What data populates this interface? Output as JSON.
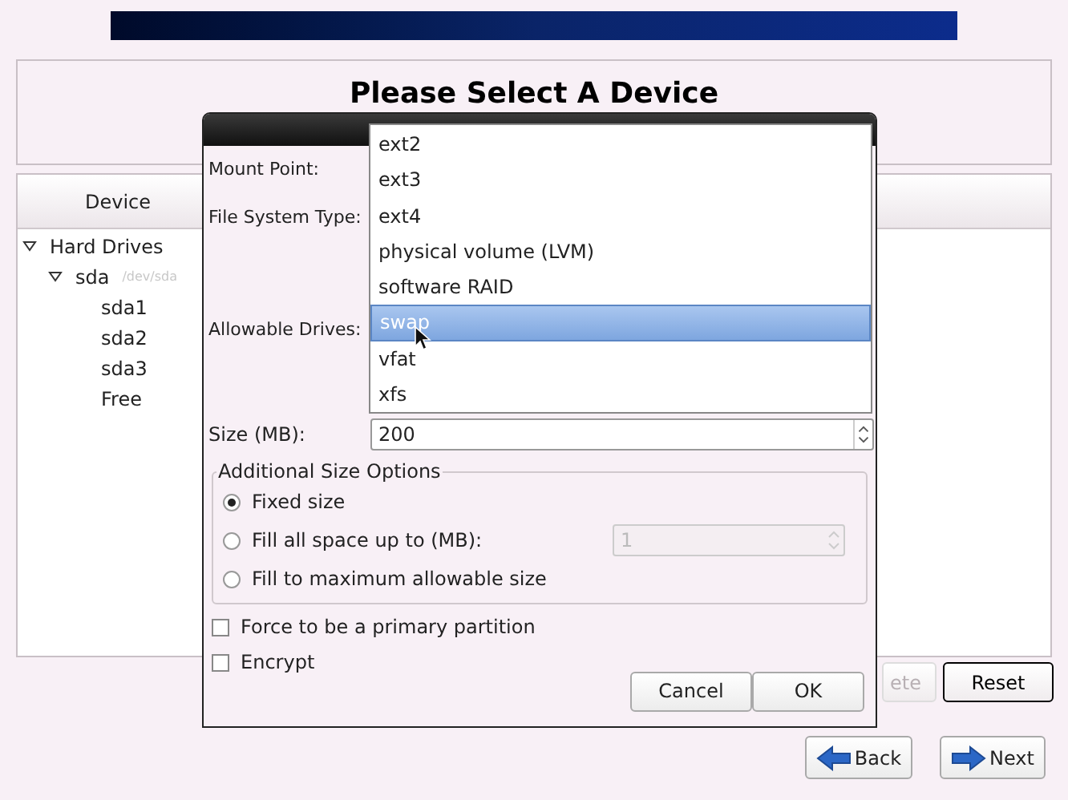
{
  "page": {
    "title": "Please Select A Device"
  },
  "device_panel": {
    "column": "Device",
    "tree": [
      {
        "label": "Hard Drives",
        "expanded": true,
        "children": [
          {
            "label": "sda",
            "path": "/dev/sda",
            "expanded": true,
            "children": [
              {
                "label": "sda1"
              },
              {
                "label": "sda2"
              },
              {
                "label": "sda3"
              },
              {
                "label": "Free"
              }
            ]
          }
        ]
      }
    ]
  },
  "panel_buttons": [
    {
      "label": "ete",
      "disabled": true
    },
    {
      "label": "Reset",
      "disabled": false
    }
  ],
  "nav_buttons": [
    {
      "label": "Back",
      "kind": "back"
    },
    {
      "label": "Next",
      "kind": "next"
    }
  ],
  "dialog": {
    "labels": [
      "Mount Point:",
      "File System Type:",
      "Allowable Drives:"
    ],
    "dropdown": [
      {
        "label": "ext2",
        "selected": false
      },
      {
        "label": "ext3",
        "selected": false
      },
      {
        "label": "ext4",
        "selected": false
      },
      {
        "label": "physical volume (LVM)",
        "selected": false
      },
      {
        "label": "software RAID",
        "selected": false
      },
      {
        "label": "swap",
        "selected": true
      },
      {
        "label": "vfat",
        "selected": false
      },
      {
        "label": "xfs",
        "selected": false
      }
    ],
    "size": {
      "label": "Size (MB):",
      "value": "200"
    },
    "size_options": {
      "title": "Additional Size Options",
      "options": [
        {
          "label": "Fixed size",
          "selected": true
        },
        {
          "label": "Fill all space up to (MB):",
          "selected": false,
          "field": {
            "value": "1",
            "disabled": true
          }
        },
        {
          "label": "Fill to maximum allowable size",
          "selected": false
        }
      ]
    },
    "checkboxes": [
      {
        "label": "Force to be a primary partition",
        "checked": false
      },
      {
        "label": "Encrypt",
        "checked": false
      }
    ],
    "buttons": [
      "Cancel",
      "OK"
    ]
  }
}
